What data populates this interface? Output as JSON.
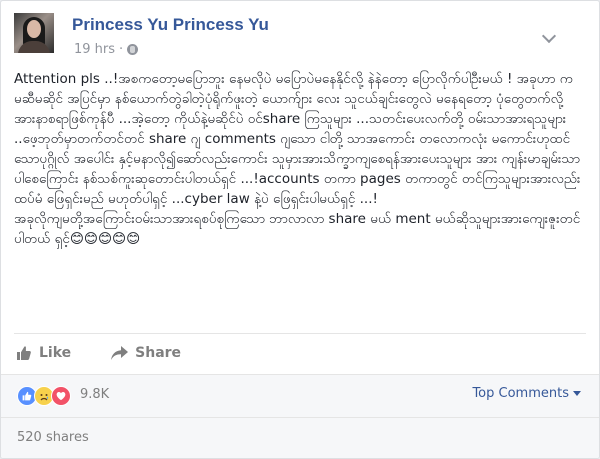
{
  "post": {
    "author_name": "Princess Yu Princess Yu",
    "timestamp": "19 hrs",
    "privacy_icon": "globe-icon",
    "text_lines": [
      "Attention pls ..!အစကတော့မပြောဘူး နေမလိုပဲ မပြောပဲမနေနိုင်လို့ နဲနဲတော့ ပြောလိုက်ပါဦးမယ် ! အခုဟာ က မဆီမဆိုင် အပြင်မှာ နစ်ယောက်တွဲခါတဲ့ပုံရိုက်ဖူးတဲ့ ယောက်ျား လေး သူငယ်ချင်းတွေလဲ မနေရတော့ ပုံတွေတက်လို့ အားနာစရာဖြစ်ကုန်ပီ ...အဲ့တော့ ကိုယ်နဲ့မဆိုင်ပဲ ဝင်share ကြသူများ ...သတင်းပေးလက်တို့ ဝမ်းသာအားရသူများ ..ဖေ့ဘုတ်မှာတက်တင်တင် share ဂျ comments ဂျသော ငါတို့ သာအကောင်း တလောကလုံး မကောင်းဟုထင်သောပုဂ္ဂိုလ် အပေါင်း နှင့်မနာလို၍ဆော်လည်းကောင်း သူမှားအားသိက္ခာကျစေရန်အားပေးသူများ အား ကျန်းမာချမ်းသာပါစေကြောင်း နစ်သစ်ကူးဆုတောင်းပါတယ်ရှင် ...!accounts တကာ pages တကာတွင် တင်ကြသူများအားလည်း ထပ်မံ ဖြေရှင်းမည် မဟုတ်ပါရှင့် ...cyber law နဲ့ပဲ ဖြေရှင်းပါမယ်ရှင့် ...!",
      "အခုလိုကျမတို့အကြောင်းဝမ်းသာအားရစပ်စုကြသော ဘာလာလာ share မယ် ment မယ်ဆိုသူများအားကျေးဇူးတင်ပါတယ် ရှင့်😊😊😊😊😊"
    ]
  },
  "actions": {
    "like_label": "Like",
    "share_label": "Share"
  },
  "reactions": {
    "types": [
      "like",
      "sad",
      "love"
    ],
    "count": "9.8K",
    "sort_label": "Top Comments",
    "shares_label": "520 shares"
  },
  "colors": {
    "name_link": "#365899",
    "meta_gray": "#90949c",
    "text": "#1d2129",
    "like_blue": "#5890ff",
    "love_red": "#f25268",
    "sad_yellow": "#f7d14c"
  }
}
